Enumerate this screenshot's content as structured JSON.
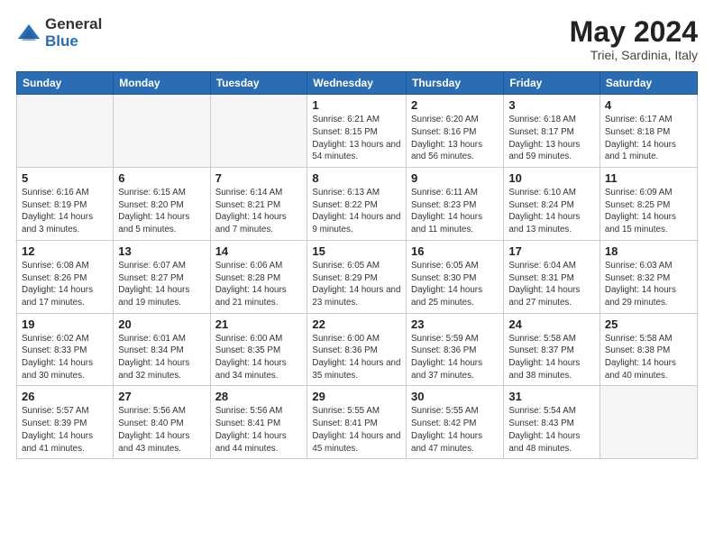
{
  "logo": {
    "general": "General",
    "blue": "Blue"
  },
  "title": {
    "month": "May 2024",
    "location": "Triei, Sardinia, Italy"
  },
  "weekdays": [
    "Sunday",
    "Monday",
    "Tuesday",
    "Wednesday",
    "Thursday",
    "Friday",
    "Saturday"
  ],
  "weeks": [
    [
      {
        "day": "",
        "sunrise": "",
        "sunset": "",
        "daylight": "",
        "empty": true
      },
      {
        "day": "",
        "sunrise": "",
        "sunset": "",
        "daylight": "",
        "empty": true
      },
      {
        "day": "",
        "sunrise": "",
        "sunset": "",
        "daylight": "",
        "empty": true
      },
      {
        "day": "1",
        "sunrise": "Sunrise: 6:21 AM",
        "sunset": "Sunset: 8:15 PM",
        "daylight": "Daylight: 13 hours and 54 minutes.",
        "empty": false
      },
      {
        "day": "2",
        "sunrise": "Sunrise: 6:20 AM",
        "sunset": "Sunset: 8:16 PM",
        "daylight": "Daylight: 13 hours and 56 minutes.",
        "empty": false
      },
      {
        "day": "3",
        "sunrise": "Sunrise: 6:18 AM",
        "sunset": "Sunset: 8:17 PM",
        "daylight": "Daylight: 13 hours and 59 minutes.",
        "empty": false
      },
      {
        "day": "4",
        "sunrise": "Sunrise: 6:17 AM",
        "sunset": "Sunset: 8:18 PM",
        "daylight": "Daylight: 14 hours and 1 minute.",
        "empty": false
      }
    ],
    [
      {
        "day": "5",
        "sunrise": "Sunrise: 6:16 AM",
        "sunset": "Sunset: 8:19 PM",
        "daylight": "Daylight: 14 hours and 3 minutes.",
        "empty": false
      },
      {
        "day": "6",
        "sunrise": "Sunrise: 6:15 AM",
        "sunset": "Sunset: 8:20 PM",
        "daylight": "Daylight: 14 hours and 5 minutes.",
        "empty": false
      },
      {
        "day": "7",
        "sunrise": "Sunrise: 6:14 AM",
        "sunset": "Sunset: 8:21 PM",
        "daylight": "Daylight: 14 hours and 7 minutes.",
        "empty": false
      },
      {
        "day": "8",
        "sunrise": "Sunrise: 6:13 AM",
        "sunset": "Sunset: 8:22 PM",
        "daylight": "Daylight: 14 hours and 9 minutes.",
        "empty": false
      },
      {
        "day": "9",
        "sunrise": "Sunrise: 6:11 AM",
        "sunset": "Sunset: 8:23 PM",
        "daylight": "Daylight: 14 hours and 11 minutes.",
        "empty": false
      },
      {
        "day": "10",
        "sunrise": "Sunrise: 6:10 AM",
        "sunset": "Sunset: 8:24 PM",
        "daylight": "Daylight: 14 hours and 13 minutes.",
        "empty": false
      },
      {
        "day": "11",
        "sunrise": "Sunrise: 6:09 AM",
        "sunset": "Sunset: 8:25 PM",
        "daylight": "Daylight: 14 hours and 15 minutes.",
        "empty": false
      }
    ],
    [
      {
        "day": "12",
        "sunrise": "Sunrise: 6:08 AM",
        "sunset": "Sunset: 8:26 PM",
        "daylight": "Daylight: 14 hours and 17 minutes.",
        "empty": false
      },
      {
        "day": "13",
        "sunrise": "Sunrise: 6:07 AM",
        "sunset": "Sunset: 8:27 PM",
        "daylight": "Daylight: 14 hours and 19 minutes.",
        "empty": false
      },
      {
        "day": "14",
        "sunrise": "Sunrise: 6:06 AM",
        "sunset": "Sunset: 8:28 PM",
        "daylight": "Daylight: 14 hours and 21 minutes.",
        "empty": false
      },
      {
        "day": "15",
        "sunrise": "Sunrise: 6:05 AM",
        "sunset": "Sunset: 8:29 PM",
        "daylight": "Daylight: 14 hours and 23 minutes.",
        "empty": false
      },
      {
        "day": "16",
        "sunrise": "Sunrise: 6:05 AM",
        "sunset": "Sunset: 8:30 PM",
        "daylight": "Daylight: 14 hours and 25 minutes.",
        "empty": false
      },
      {
        "day": "17",
        "sunrise": "Sunrise: 6:04 AM",
        "sunset": "Sunset: 8:31 PM",
        "daylight": "Daylight: 14 hours and 27 minutes.",
        "empty": false
      },
      {
        "day": "18",
        "sunrise": "Sunrise: 6:03 AM",
        "sunset": "Sunset: 8:32 PM",
        "daylight": "Daylight: 14 hours and 29 minutes.",
        "empty": false
      }
    ],
    [
      {
        "day": "19",
        "sunrise": "Sunrise: 6:02 AM",
        "sunset": "Sunset: 8:33 PM",
        "daylight": "Daylight: 14 hours and 30 minutes.",
        "empty": false
      },
      {
        "day": "20",
        "sunrise": "Sunrise: 6:01 AM",
        "sunset": "Sunset: 8:34 PM",
        "daylight": "Daylight: 14 hours and 32 minutes.",
        "empty": false
      },
      {
        "day": "21",
        "sunrise": "Sunrise: 6:00 AM",
        "sunset": "Sunset: 8:35 PM",
        "daylight": "Daylight: 14 hours and 34 minutes.",
        "empty": false
      },
      {
        "day": "22",
        "sunrise": "Sunrise: 6:00 AM",
        "sunset": "Sunset: 8:36 PM",
        "daylight": "Daylight: 14 hours and 35 minutes.",
        "empty": false
      },
      {
        "day": "23",
        "sunrise": "Sunrise: 5:59 AM",
        "sunset": "Sunset: 8:36 PM",
        "daylight": "Daylight: 14 hours and 37 minutes.",
        "empty": false
      },
      {
        "day": "24",
        "sunrise": "Sunrise: 5:58 AM",
        "sunset": "Sunset: 8:37 PM",
        "daylight": "Daylight: 14 hours and 38 minutes.",
        "empty": false
      },
      {
        "day": "25",
        "sunrise": "Sunrise: 5:58 AM",
        "sunset": "Sunset: 8:38 PM",
        "daylight": "Daylight: 14 hours and 40 minutes.",
        "empty": false
      }
    ],
    [
      {
        "day": "26",
        "sunrise": "Sunrise: 5:57 AM",
        "sunset": "Sunset: 8:39 PM",
        "daylight": "Daylight: 14 hours and 41 minutes.",
        "empty": false
      },
      {
        "day": "27",
        "sunrise": "Sunrise: 5:56 AM",
        "sunset": "Sunset: 8:40 PM",
        "daylight": "Daylight: 14 hours and 43 minutes.",
        "empty": false
      },
      {
        "day": "28",
        "sunrise": "Sunrise: 5:56 AM",
        "sunset": "Sunset: 8:41 PM",
        "daylight": "Daylight: 14 hours and 44 minutes.",
        "empty": false
      },
      {
        "day": "29",
        "sunrise": "Sunrise: 5:55 AM",
        "sunset": "Sunset: 8:41 PM",
        "daylight": "Daylight: 14 hours and 45 minutes.",
        "empty": false
      },
      {
        "day": "30",
        "sunrise": "Sunrise: 5:55 AM",
        "sunset": "Sunset: 8:42 PM",
        "daylight": "Daylight: 14 hours and 47 minutes.",
        "empty": false
      },
      {
        "day": "31",
        "sunrise": "Sunrise: 5:54 AM",
        "sunset": "Sunset: 8:43 PM",
        "daylight": "Daylight: 14 hours and 48 minutes.",
        "empty": false
      },
      {
        "day": "",
        "sunrise": "",
        "sunset": "",
        "daylight": "",
        "empty": true
      }
    ]
  ]
}
